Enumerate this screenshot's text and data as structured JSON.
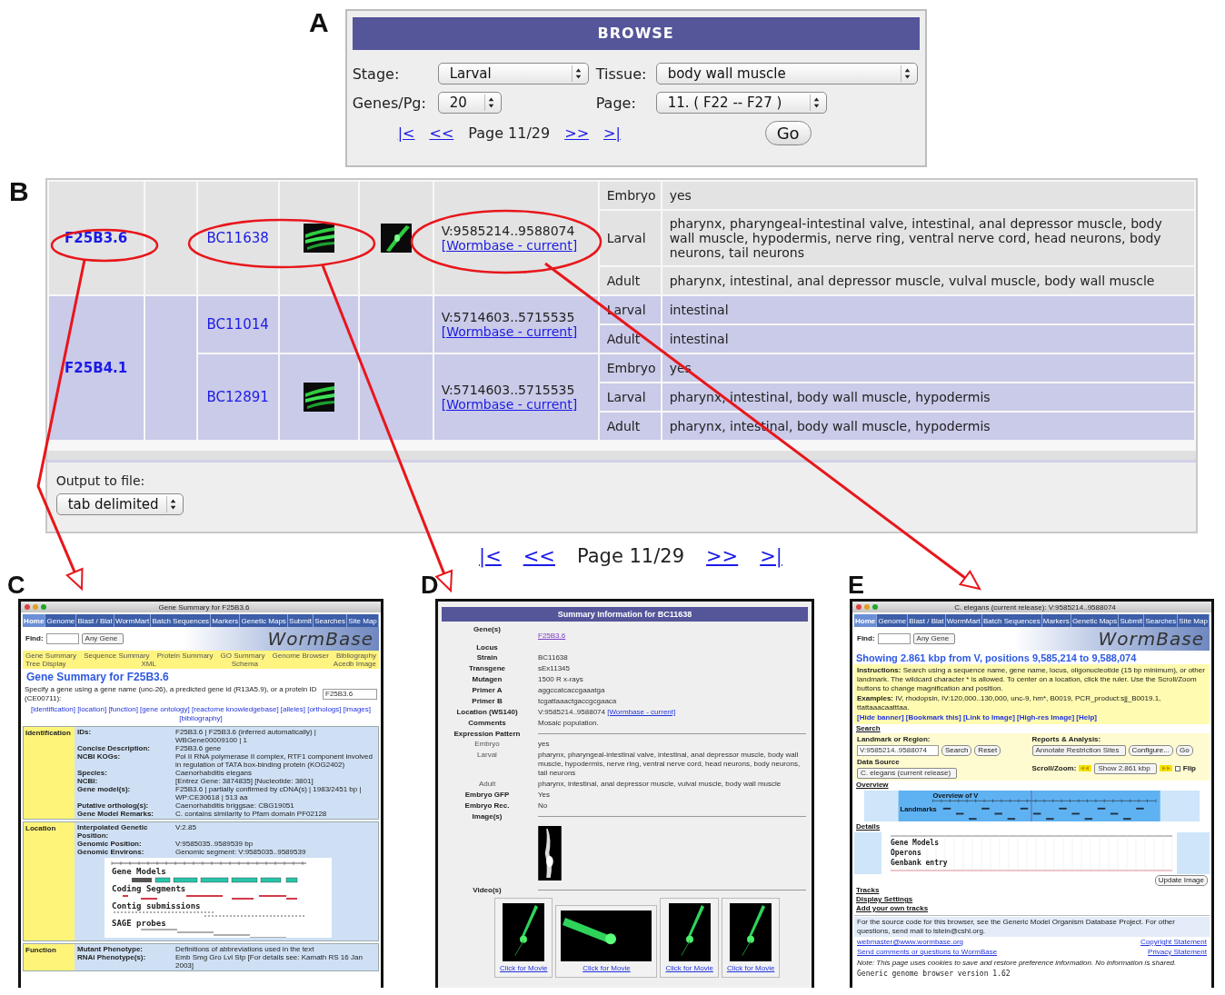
{
  "browse": {
    "label": "A",
    "title": "BROWSE",
    "fields": [
      {
        "label": "Stage:",
        "value": "Larval"
      },
      {
        "label": "Tissue:",
        "value": "body wall muscle"
      },
      {
        "label": "Genes/Pg:",
        "value": "20"
      },
      {
        "label": "Page:",
        "value": "11. ( F22 -- F27 )"
      }
    ],
    "pager": {
      "first": "|<",
      "prev": "<<",
      "page": "Page 11/29",
      "next": ">>",
      "last": ">|"
    },
    "go_button": "Go"
  },
  "results": {
    "label": "B",
    "genes": [
      {
        "name": "F25B3.6",
        "strains": [
          {
            "name": "BC11638",
            "images": [
              {
                "kind": "picture"
              },
              {
                "kind": "picture"
              }
            ],
            "location": "V:9585214..9588074",
            "link": "[Wormbase - current]",
            "stages": [
              {
                "stage": "Embryo",
                "tissues": "yes"
              },
              {
                "stage": "Larval",
                "tissues": "pharynx, pharyngeal-intestinal valve, intestinal, anal depressor muscle, body wall muscle, hypodermis, nerve ring, ventral nerve cord, head neurons, body neurons, tail neurons"
              },
              {
                "stage": "Adult",
                "tissues": "pharynx, intestinal, anal depressor muscle, vulval muscle, body wall muscle"
              }
            ]
          }
        ]
      },
      {
        "name": "F25B4.1",
        "strains": [
          {
            "name": "BC11014",
            "location": "V:5714603..5715535",
            "link": "[Wormbase - current]",
            "stages": [
              {
                "stage": "Larval",
                "tissues": "intestinal"
              },
              {
                "stage": "Adult",
                "tissues": "intestinal"
              }
            ]
          },
          {
            "name": "BC12891",
            "images": [
              {
                "kind": "picture"
              }
            ],
            "location": "V:5714603..5715535",
            "link": "[Wormbase - current]",
            "stages": [
              {
                "stage": "Embryo",
                "tissues": "yes"
              },
              {
                "stage": "Larval",
                "tissues": "pharynx, intestinal, body wall muscle, hypodermis"
              },
              {
                "stage": "Adult",
                "tissues": "pharynx, intestinal, body wall muscle, hypodermis"
              }
            ]
          }
        ]
      }
    ],
    "output_label": "Output to file:",
    "output_format": "tab delimited"
  },
  "pager": {
    "first": "|<",
    "prev": "<<",
    "page": "Page 11/29",
    "next": ">>",
    "last": ">|"
  },
  "gene_summary": {
    "label": "C",
    "window_title": "Gene Summary for F25B3.6",
    "nav": [
      {
        "label": "Home",
        "selected": true
      },
      {
        "label": "Genome",
        "selected": false
      },
      {
        "label": "Blast / Blat",
        "selected": false
      },
      {
        "label": "WormMart",
        "selected": false
      },
      {
        "label": "Batch Sequences",
        "selected": false
      },
      {
        "label": "Markers",
        "selected": false
      },
      {
        "label": "Genetic Maps",
        "selected": false
      },
      {
        "label": "Submit",
        "selected": false
      },
      {
        "label": "Searches",
        "selected": false
      },
      {
        "label": "Site Map",
        "selected": false
      }
    ],
    "find_label": "Find:",
    "find_option": "Any Gene",
    "logo": "WormBase",
    "subnav": [
      "Gene Summary",
      "Sequence Summary",
      "Protein Summary",
      "GO Summary",
      "Genome Browser",
      "Bibliography",
      "Tree Display",
      "XML",
      "Schema",
      "Acedb Image"
    ],
    "heading": "Gene Summary for F25B3.6",
    "prompt": "Specify a gene using a gene name (unc-26), a predicted gene id (R13A5.9), or a protein ID (CE00711):",
    "query": "F25B3.6",
    "section_links": "[identification] [location] [function] [gene ontology] [reactome knowledgebase] [alleles] [orthologs] [images] [bibliography]",
    "sections": [
      {
        "title": "Identification",
        "rows": [
          {
            "label": "IDs:",
            "value": "F25B3.6 | F25B3.6 (inferred automatically) | WBGene00009100 | 1"
          },
          {
            "label": "Concise Description:",
            "value": "F25B3.6 gene"
          },
          {
            "label": "NCBI KOGs:",
            "value": "Pol II RNA polymerase II complex, RTF1 component involved in regulation of TATA box-binding protein (KOG2402)"
          },
          {
            "label": "Species:",
            "value": "Caenorhabditis elegans"
          },
          {
            "label": "NCBI:",
            "value": "[Entrez Gene: 3874835] [Nucleotide: 3801]"
          },
          {
            "label": "Gene model(s):",
            "value": "F25B3.6 | partially confirmed by cDNA(s) | 1983/2451 bp | WP:CE30618 | 513 aa"
          },
          {
            "label": "Putative ortholog(s):",
            "value": "Caenorhabditis briggsae: CBG19051"
          },
          {
            "label": "Gene Model Remarks:",
            "value": "C. contains similarity to Pfam domain PF02128"
          }
        ]
      },
      {
        "title": "Location",
        "rows": [
          {
            "label": "Interpolated Genetic Position:",
            "value": "V:2.85"
          },
          {
            "label": "Genomic Position:",
            "value": "V:9585035..9589539 bp"
          },
          {
            "label": "Genomic Environs:",
            "value": "Genomic segment: V:9585035..9589539"
          }
        ],
        "tracks": [
          "Gene Models",
          "Coding Segments",
          "Contig submissions",
          "SAGE probes"
        ]
      },
      {
        "title": "Function",
        "rows": [
          {
            "label": "Mutant Phenotype:",
            "value": "Definitions of abbreviations used in the text"
          },
          {
            "label": "RNAi Phenotype(s):",
            "value": "Emb Smg Gro Lvl Stp [For details see: Kamath RS 16 Jan 2003]"
          }
        ]
      }
    ]
  },
  "strain_summary": {
    "label": "D",
    "title": "Summary Information for BC11638",
    "fields": [
      {
        "label": "Gene(s)",
        "value": "F25B3.6",
        "kind": "link"
      },
      {
        "label": "Locus",
        "kind": "text"
      },
      {
        "label": "Strain",
        "value": "BC11638",
        "kind": "text"
      },
      {
        "label": "Transgene",
        "value": "sEx11345",
        "kind": "text"
      },
      {
        "label": "Mutagen",
        "value": "1500 R x-rays",
        "kind": "text"
      },
      {
        "label": "Primer A",
        "value": "aggccatcaccgaaatga",
        "kind": "text"
      },
      {
        "label": "Primer B",
        "value": "tcgattaaactgaccgcgaaca",
        "kind": "text"
      },
      {
        "label": "Location (WS140)",
        "value": "V:9585214..9588074",
        "link": "[Wormbase - current]",
        "kind": "text"
      },
      {
        "label": "Comments",
        "value": "Mosaic population.",
        "kind": "text"
      },
      {
        "label": "Expression Pattern",
        "kind": "section"
      },
      {
        "label": "Embryo",
        "value": "yes",
        "kind": "sub"
      },
      {
        "label": "Larval",
        "value": "pharynx, pharyngeal-intestinal valve, intestinal, anal depressor muscle, body wall muscle, hypodermis, nerve ring, ventral nerve cord, head neurons, body neurons, tail neurons",
        "kind": "sub"
      },
      {
        "label": "Adult",
        "value": "pharynx, intestinal, anal depressor muscle, vulval muscle, body wall muscle",
        "kind": "sub"
      },
      {
        "label": "Embryo GFP",
        "value": "Yes",
        "kind": "text"
      },
      {
        "label": "Embryo Rec.",
        "value": "No",
        "kind": "text"
      }
    ],
    "images_label": "Image(s)",
    "videos_label": "Video(s)",
    "videos": [
      {
        "link": "Click for Movie"
      },
      {
        "link": "Click for Movie"
      },
      {
        "link": "Click for Movie"
      },
      {
        "link": "Click for Movie"
      }
    ]
  },
  "genome_browser": {
    "label": "E",
    "window_title": "C. elegans (current release): V:9585214..9588074",
    "nav": [
      {
        "label": "Home",
        "selected": true
      },
      {
        "label": "Genome",
        "selected": false
      },
      {
        "label": "Blast / Blat",
        "selected": false
      },
      {
        "label": "WormMart",
        "selected": false
      },
      {
        "label": "Batch Sequences",
        "selected": false
      },
      {
        "label": "Markers",
        "selected": false
      },
      {
        "label": "Genetic Maps",
        "selected": false
      },
      {
        "label": "Submit",
        "selected": false
      },
      {
        "label": "Searches",
        "selected": false
      },
      {
        "label": "Site Map",
        "selected": false
      }
    ],
    "find_label": "Find:",
    "find_option": "Any Gene",
    "logo": "WormBase",
    "heading": "Showing 2.861 kbp from V, positions 9,585,214 to 9,588,074",
    "instructions": "**Instructions:** Search using a sequence name, gene name, locus, oligonucleotide (15 bp minimum), or other landmark. The wildcard character * is allowed. To center on a location, click the ruler. Use the Scroll/Zoom buttons to change magnification and position.",
    "examples": "**Examples:** IV, rhodopsin, IV:120,000..130,000, unc-9, hm*, B0019, PCR_product:sjj_B0019.1, ttattaaacaatttaa.",
    "banner_links": "[Hide banner] [Bookmark this] [Link to Image] [High-res Image] [Help]",
    "search_title": "Search",
    "landmark_label": "Landmark or Region:",
    "landmark_value": "V:9585214..9588074",
    "search_button": "Search",
    "reset_button": "Reset",
    "reports_label": "Reports & Analysis:",
    "reports_option": "Annotate Restriction Sites",
    "configure_button": "Configure...",
    "go_button": "Go",
    "source_label": "Data Source",
    "source_option": "C. elegans (current release)",
    "zoom_label": "Scroll/Zoom:",
    "zoom_option": "Show 2.861 kbp",
    "flip_label": "Flip",
    "overview_title": "Overview",
    "overview_caption": "Overview of V",
    "landmarks_label": "Landmarks",
    "details_title": "Details",
    "detail_tracks": [
      "Gene Models",
      "Operons",
      "Genbank entry"
    ],
    "update_button": "Update Image",
    "sections": [
      "Tracks",
      "Display Settings",
      "Add your own tracks"
    ],
    "footer": "For the source code for this browser, see the Generic Model Organism Database Project. For other questions, send mail to lstein@cshl.org.",
    "contact": "webmaster@www.wormbase.org",
    "comments": "Send comments or questions to WormBase",
    "copyright": "Copyright Statement",
    "privacy": "Privacy Statement",
    "note": "Note: This page uses cookies to save and restore preference information. No information is shared.",
    "version": "Generic genome browser version 1.62"
  }
}
